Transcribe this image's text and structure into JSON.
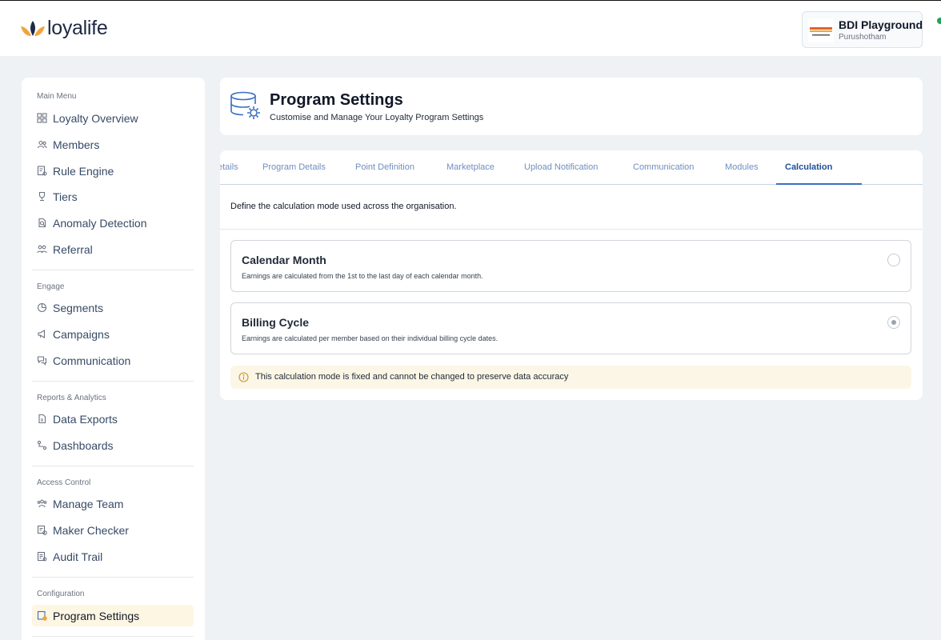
{
  "brand": {
    "name": "loyalife"
  },
  "account": {
    "name": "BDI Playground",
    "user": "Purushotham"
  },
  "colors": {
    "accent": "#3b6fc1",
    "brand_orange": "#f2a33a",
    "brand_navy": "#1e2a44",
    "active_nav_bg": "#fdf6e3",
    "notice_bg": "#fbf6e6"
  },
  "sidebar": {
    "sections": [
      {
        "label": "Main Menu",
        "items": [
          {
            "label": "Loyalty Overview",
            "icon": "dashboard-grid-icon"
          },
          {
            "label": "Members",
            "icon": "members-icon"
          },
          {
            "label": "Rule Engine",
            "icon": "rule-engine-icon"
          },
          {
            "label": "Tiers",
            "icon": "trophy-icon"
          },
          {
            "label": "Anomaly Detection",
            "icon": "anomaly-icon"
          },
          {
            "label": "Referral",
            "icon": "referral-icon"
          }
        ]
      },
      {
        "label": "Engage",
        "items": [
          {
            "label": "Segments",
            "icon": "pie-chart-icon"
          },
          {
            "label": "Campaigns",
            "icon": "megaphone-icon"
          },
          {
            "label": "Communication",
            "icon": "chat-icon"
          }
        ]
      },
      {
        "label": "Reports & Analytics",
        "items": [
          {
            "label": "Data Exports",
            "icon": "file-export-icon"
          },
          {
            "label": "Dashboards",
            "icon": "nodes-icon"
          }
        ]
      },
      {
        "label": "Access Control",
        "items": [
          {
            "label": "Manage Team",
            "icon": "team-icon"
          },
          {
            "label": "Maker Checker",
            "icon": "maker-checker-icon"
          },
          {
            "label": "Audit Trail",
            "icon": "audit-icon"
          }
        ]
      },
      {
        "label": "Configuration",
        "items": [
          {
            "label": "Program Settings",
            "icon": "settings-doc-icon",
            "active": true
          }
        ]
      }
    ]
  },
  "header": {
    "title": "Program Settings",
    "subtitle": "Customise and Manage Your Loyalty Program Settings",
    "icon": "database-gear-icon"
  },
  "tabs": [
    {
      "label": "etails"
    },
    {
      "label": "Program Details"
    },
    {
      "label": "Point Definition"
    },
    {
      "label": "Marketplace"
    },
    {
      "label": "Upload Notification"
    },
    {
      "label": "Communication"
    },
    {
      "label": "Modules"
    },
    {
      "label": "Calculation",
      "active": true
    }
  ],
  "calculation": {
    "description": "Define the calculation mode used across the organisation.",
    "options": [
      {
        "title": "Calendar Month",
        "description": "Earnings are calculated from the 1st to the last day of each calendar month.",
        "selected": false
      },
      {
        "title": "Billing Cycle",
        "description": "Earnings are calculated per member based on their individual billing cycle dates.",
        "selected": true
      }
    ],
    "notice": {
      "icon": "info-icon",
      "text": "This calculation mode is fixed and cannot be changed to preserve data accuracy"
    }
  }
}
